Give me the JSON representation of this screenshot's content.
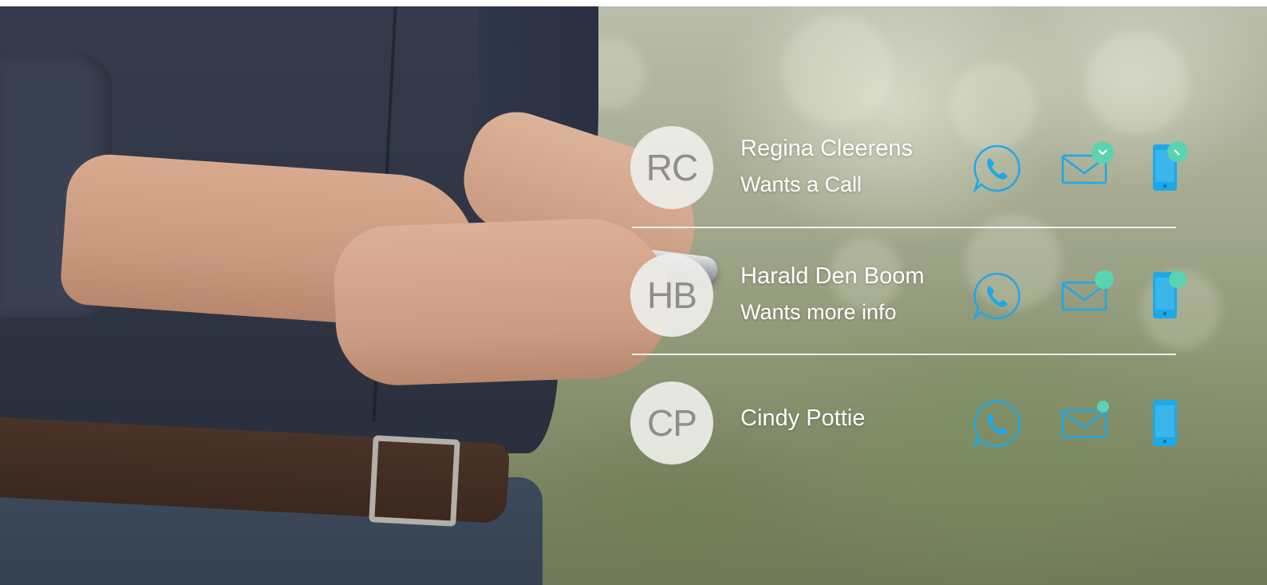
{
  "colors": {
    "accent": "#1ba9e8",
    "badge": "#5ad3b0",
    "text": "#ffffff",
    "avatar_bg": "#eeeeec",
    "avatar_text": "#8e8e8a"
  },
  "contacts": [
    {
      "initials": "RC",
      "name": "Regina Cleerens",
      "status": "Wants a Call",
      "icons": [
        "whatsapp-icon",
        "mail-icon",
        "mobile-phone-icon"
      ],
      "mail_badge": "check",
      "phone_badge": "check"
    },
    {
      "initials": "HB",
      "name": "Harald Den Boom",
      "status": "Wants more info",
      "icons": [
        "whatsapp-icon",
        "mail-icon",
        "mobile-phone-icon"
      ],
      "mail_badge": "dot",
      "phone_badge": "dot"
    },
    {
      "initials": "CP",
      "name": "Cindy Pottie",
      "status": "",
      "icons": [
        "whatsapp-icon",
        "mail-icon",
        "mobile-phone-icon"
      ],
      "mail_badge": "dot",
      "phone_badge": "none"
    }
  ]
}
